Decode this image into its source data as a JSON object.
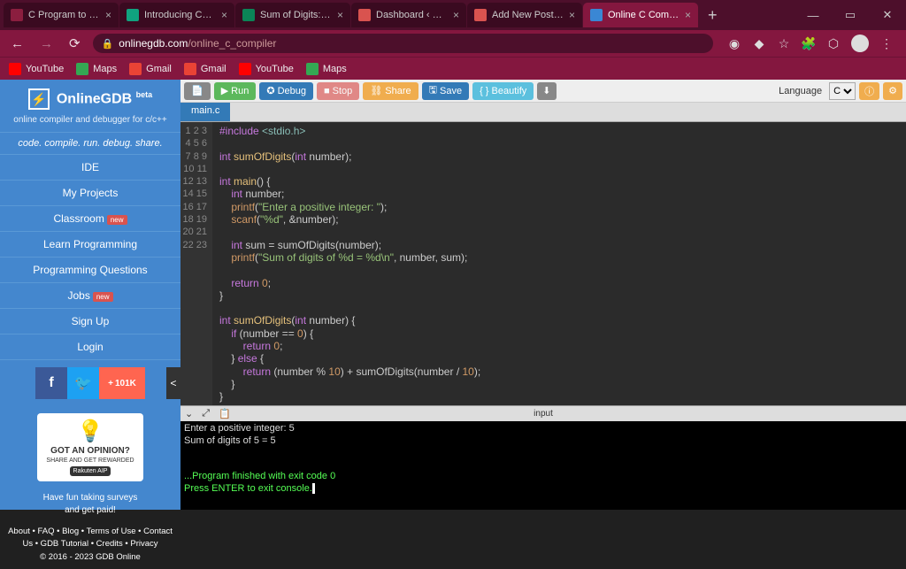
{
  "browser": {
    "tabs": [
      {
        "title": "C Program to Find the",
        "fav": "#8b1e3f"
      },
      {
        "title": "Introducing ChatGPT",
        "fav": "#10a37f"
      },
      {
        "title": "Sum of Digits: Recurs",
        "fav": "#0b8457"
      },
      {
        "title": "Dashboard ‹ Develope",
        "fav": "#d9534f"
      },
      {
        "title": "Add New Post ‹ Devel",
        "fav": "#d9534f"
      },
      {
        "title": "Online C Compiler - o",
        "fav": "#3a87d4",
        "active": true
      }
    ],
    "url_domain": "onlinegdb.com",
    "url_path": "/online_c_compiler",
    "bookmarks": [
      {
        "label": "YouTube",
        "color": "#ff0000"
      },
      {
        "label": "Maps",
        "color": "#34a853"
      },
      {
        "label": "Gmail",
        "color": "#ea4335"
      },
      {
        "label": "Gmail",
        "color": "#ea4335"
      },
      {
        "label": "YouTube",
        "color": "#ff0000"
      },
      {
        "label": "Maps",
        "color": "#34a853"
      }
    ]
  },
  "sidebar": {
    "brand": "OnlineGDB",
    "beta": "beta",
    "subtitle": "online compiler and debugger for c/c++",
    "tagline": "code. compile. run. debug. share.",
    "items": [
      {
        "label": "IDE"
      },
      {
        "label": "My Projects"
      },
      {
        "label": "Classroom",
        "badge": "new"
      },
      {
        "label": "Learn Programming"
      },
      {
        "label": "Programming Questions"
      },
      {
        "label": "Jobs",
        "badge": "new"
      },
      {
        "label": "Sign Up"
      },
      {
        "label": "Login"
      }
    ],
    "share_count": "101K",
    "promo": {
      "title": "GOT AN OPINION?",
      "sub": "SHARE AND GET REWARDED",
      "brand": "Rakuten AIP",
      "text1": "Have fun taking surveys",
      "text2": "and get paid!"
    },
    "footer": "About • FAQ • Blog • Terms of Use • Contact Us • GDB Tutorial • Credits • Privacy",
    "copyright": "© 2016 - 2023 GDB Online"
  },
  "toolbar": {
    "run": "Run",
    "debug": "Debug",
    "stop": "Stop",
    "share": "Share",
    "save": "Save",
    "beautify": "{ } Beautify",
    "lang_label": "Language",
    "lang_value": "C"
  },
  "file_tab": "main.c",
  "code_lines": 23,
  "terminal": {
    "label": "input",
    "l1": "Enter a positive integer: 5",
    "l2": "Sum of digits of 5 = 5",
    "l3": "...Program finished with exit code 0",
    "l4": "Press ENTER to exit console."
  }
}
